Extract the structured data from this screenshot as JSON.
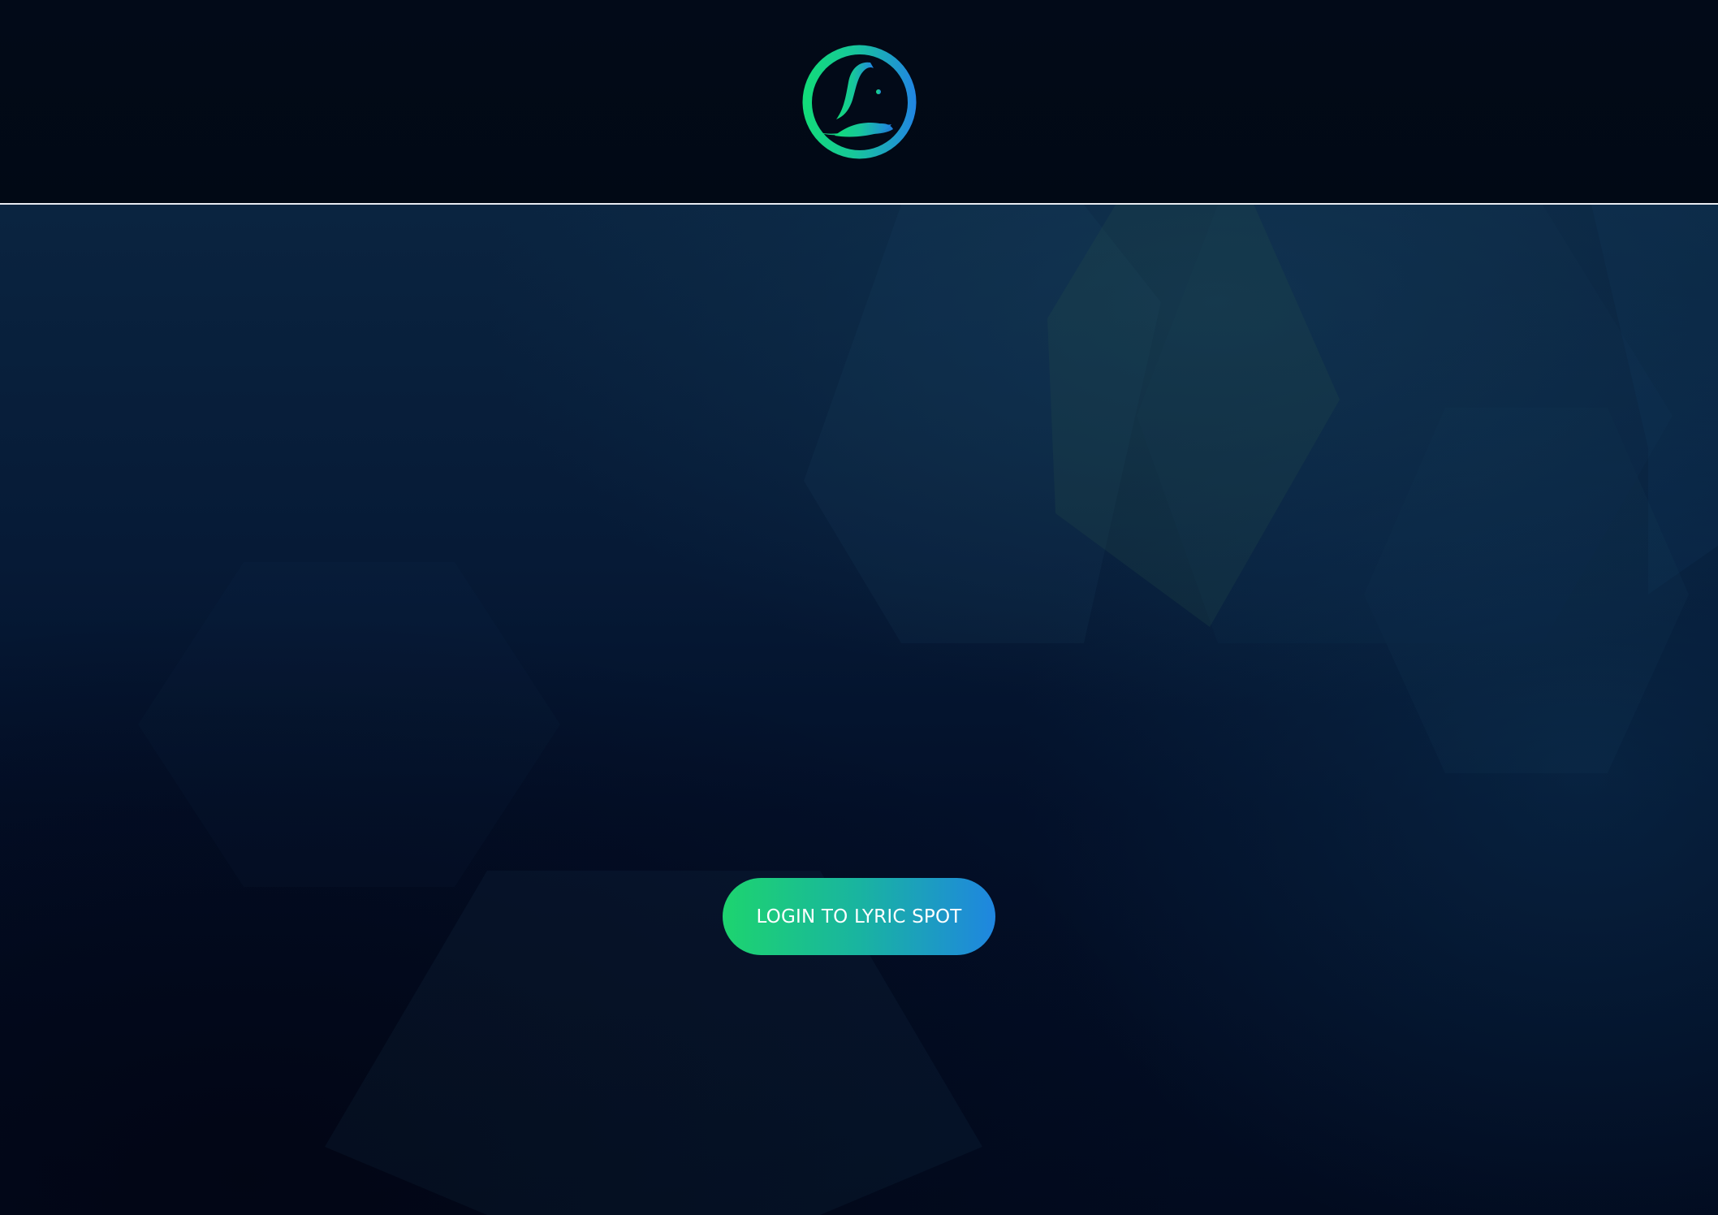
{
  "app": {
    "logo_icon": "lyric-spot-logo-icon",
    "brand_colors": {
      "gradient_start": "#1dd46f",
      "gradient_end": "#1f86e0",
      "header_background": "#020a18",
      "divider": "#e8ecf2"
    }
  },
  "main": {
    "login_button_label": "LOGIN TO LYRIC SPOT"
  }
}
